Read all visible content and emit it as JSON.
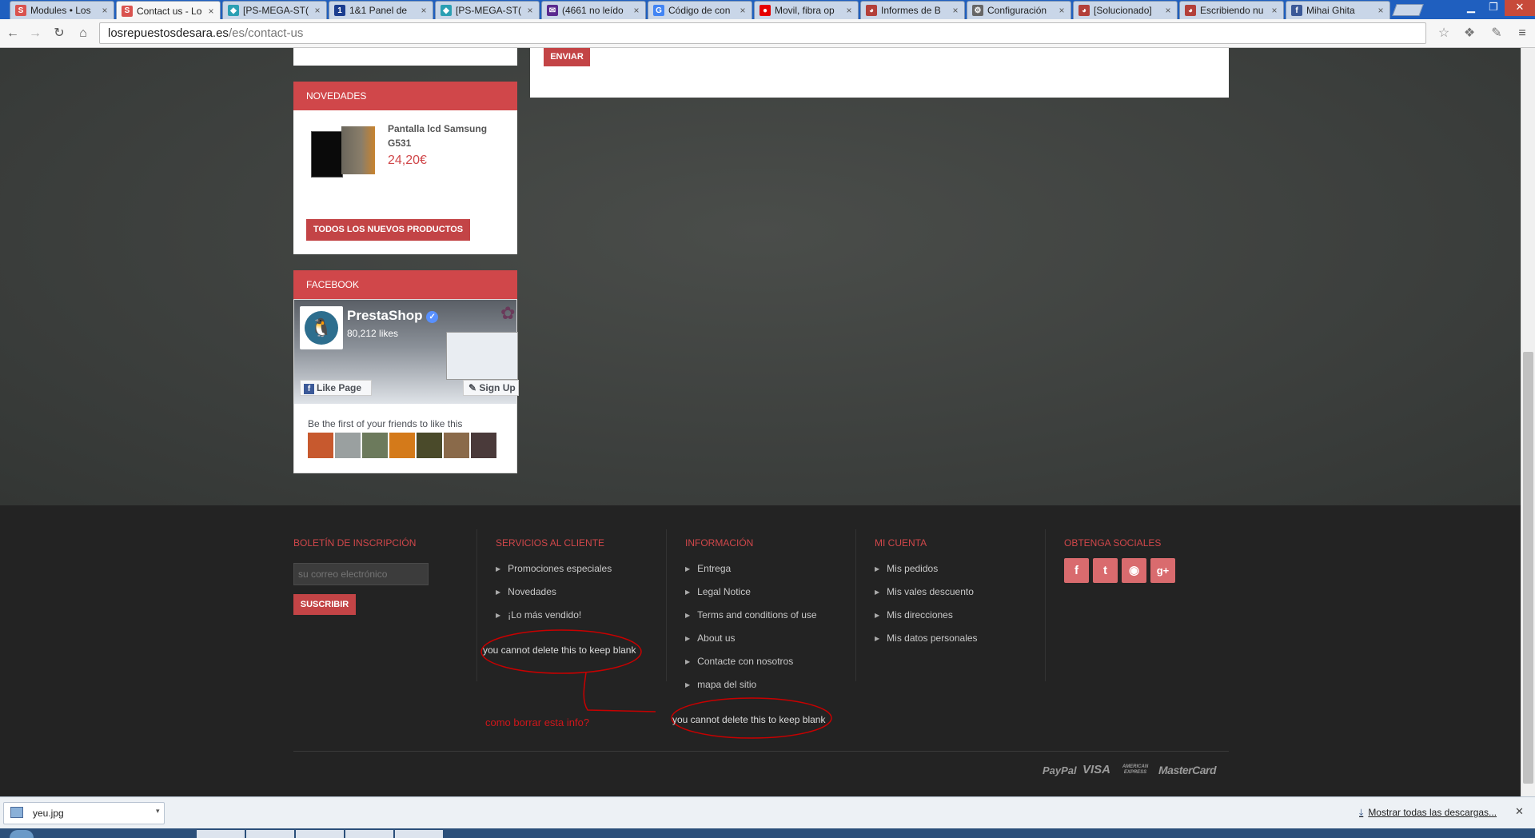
{
  "browser": {
    "tabs": [
      {
        "title": "Modules • Los",
        "favicon": "S",
        "color": "#d9534f"
      },
      {
        "title": "Contact us - Lo",
        "favicon": "S",
        "color": "#d9534f",
        "active": true
      },
      {
        "title": "[PS-MEGA-ST(",
        "favicon": "◆",
        "color": "#2a9fb3"
      },
      {
        "title": "1&1 Panel de",
        "favicon": "1",
        "color": "#1b3d8f"
      },
      {
        "title": "[PS-MEGA-ST(",
        "favicon": "◆",
        "color": "#2a9fb3"
      },
      {
        "title": "(4661 no leído",
        "favicon": "✉",
        "color": "#5a2a8f"
      },
      {
        "title": "Código de con",
        "favicon": "G",
        "color": "#4285f4"
      },
      {
        "title": "Movil, fibra op",
        "favicon": "●",
        "color": "#e60000"
      },
      {
        "title": "Informes de B",
        "favicon": "◕",
        "color": "#b3403a"
      },
      {
        "title": "Configuración",
        "favicon": "⚙",
        "color": "#666666"
      },
      {
        "title": "[Solucionado]",
        "favicon": "◕",
        "color": "#b3403a"
      },
      {
        "title": "Escribiendo nu",
        "favicon": "◕",
        "color": "#b3403a"
      },
      {
        "title": "Mihai Ghita",
        "favicon": "f",
        "color": "#3b5998"
      }
    ],
    "url_domain": "losrepuestosdesara.es",
    "url_path": "/es/contact-us"
  },
  "contact": {
    "send_label": "ENVIAR"
  },
  "novedades": {
    "heading": "NOVEDADES",
    "product_name": "Pantalla lcd Samsung G531",
    "price": "24,20€",
    "all_button": "TODOS LOS NUEVOS PRODUCTOS"
  },
  "facebook": {
    "heading": "FACEBOOK",
    "page_name": "PrestaShop",
    "likes": "80,212 likes",
    "like_button": "Like Page",
    "signup_button": "Sign Up",
    "friends_text": "Be the first of your friends to like this"
  },
  "footer": {
    "newsletter": {
      "heading": "BOLETÍN DE INSCRIPCIÓN",
      "placeholder": "su correo electrónico",
      "button": "SUSCRIBIR"
    },
    "services": {
      "heading": "SERVICIOS AL CLIENTE",
      "links": [
        "Promociones especiales",
        "Novedades",
        "¡Lo más vendido!"
      ]
    },
    "info": {
      "heading": "INFORMACIÓN",
      "links": [
        "Entrega",
        "Legal Notice",
        "Terms and conditions of use",
        "About us",
        "Contacte con nosotros",
        "mapa del sitio"
      ]
    },
    "account": {
      "heading": "MI CUENTA",
      "links": [
        "Mis pedidos",
        "Mis vales descuento",
        "Mis direcciones",
        "Mis datos personales"
      ]
    },
    "social": {
      "heading": "OBTENGA SOCIALES",
      "icons": [
        "facebook-icon",
        "twitter-icon",
        "rss-icon",
        "google-plus-icon"
      ]
    },
    "annotations": {
      "note1": "you cannot delete this to keep blank",
      "note2": "you cannot delete this to keep blank",
      "question": "como borrar esta info?"
    },
    "payments": [
      "PayPal",
      "VISA",
      "AMERICAN EXPRESS",
      "MasterCard"
    ]
  },
  "downloads": {
    "file": "yeu.jpg",
    "show_all": "Mostrar todas las descargas..."
  },
  "colors": {
    "accent": "#d0474a",
    "footer_bg": "#232323",
    "page_bg": "#3b3e3c"
  }
}
